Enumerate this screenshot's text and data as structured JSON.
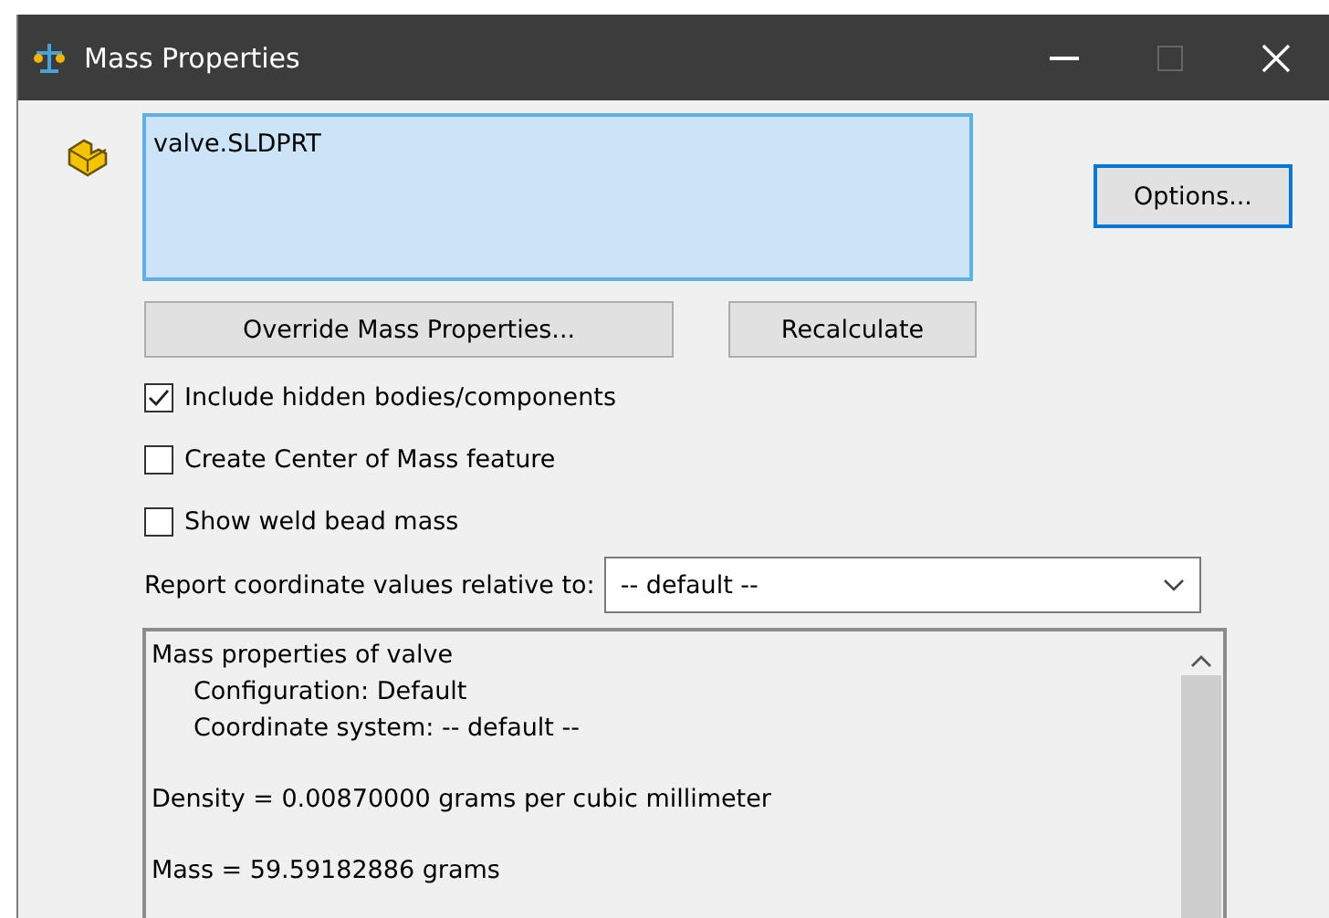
{
  "window": {
    "title": "Mass Properties",
    "maximize_disabled": true
  },
  "selection_list": {
    "items": [
      "valve.SLDPRT"
    ]
  },
  "buttons": [
    {
      "label": "Options...",
      "focused": true
    },
    {
      "label": "Override Mass Properties...",
      "focused": false
    },
    {
      "label": "Recalculate",
      "focused": false
    }
  ],
  "options": [
    {
      "label": "Include hidden bodies/components",
      "checked": true
    },
    {
      "label": "Create Center of Mass feature",
      "checked": false
    },
    {
      "label": "Show weld bead mass",
      "checked": false
    }
  ],
  "coordinate_system": {
    "label": "Report coordinate values relative to:",
    "value": "-- default --"
  },
  "results": [
    {
      "text": "Mass properties of valve",
      "indented": false,
      "gap_before": false
    },
    {
      "text": "Configuration: Default",
      "indented": true,
      "gap_before": false
    },
    {
      "text": "Coordinate system: -- default --",
      "indented": true,
      "gap_before": false
    },
    {
      "text": "Density = 0.00870000 grams per cubic millimeter",
      "indented": false,
      "gap_before": true
    },
    {
      "text": "Mass = 59.59182886 grams",
      "indented": false,
      "gap_before": true
    }
  ]
}
